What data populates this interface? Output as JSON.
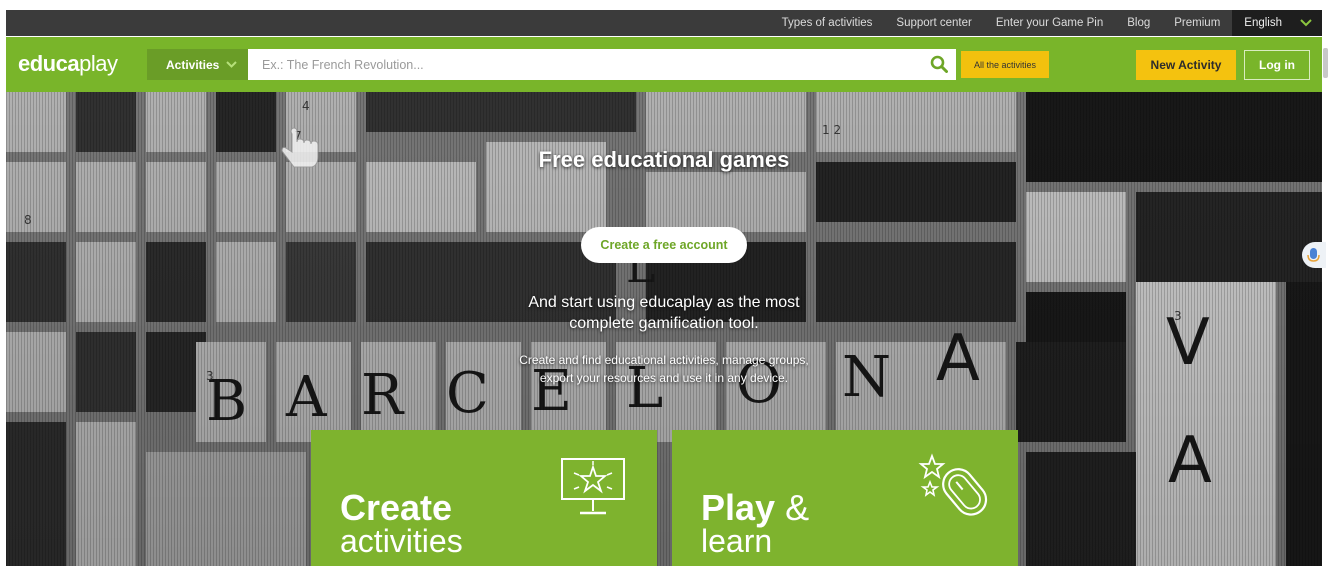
{
  "topbar": {
    "links": [
      "Types of activities",
      "Support center",
      "Enter your Game Pin",
      "Blog",
      "Premium"
    ],
    "language": "English"
  },
  "navbar": {
    "logo_bold": "educa",
    "logo_light": "play",
    "activities_select": "Activities",
    "search_placeholder": "Ex.: The French Revolution...",
    "all_activities": "All the activities",
    "new_activity": "New Activity",
    "login": "Log in"
  },
  "hero": {
    "title": "Free educational games",
    "cta": "Create a free account",
    "subtitle_line1": "And start using educaplay as the most",
    "subtitle_line2": "complete gamification tool.",
    "desc_line1": "Create and find educational activities, manage groups,",
    "desc_line2": "export your resources and use it in any device.",
    "crossword_word": "BARCELONA"
  },
  "cards": {
    "create": {
      "title": "Create",
      "subtitle": "activities"
    },
    "play": {
      "title": "Play",
      "amp": "&",
      "subtitle": "learn"
    }
  },
  "colors": {
    "brand_green": "#79b52a",
    "card_green": "#7eb32e",
    "accent_yellow": "#f4c20f",
    "topbar_dark": "#3b3b3b"
  },
  "icons": [
    "chevron-down-icon",
    "search-icon",
    "presentation-star-icon",
    "mouse-stars-icon",
    "microphone-icon"
  ]
}
